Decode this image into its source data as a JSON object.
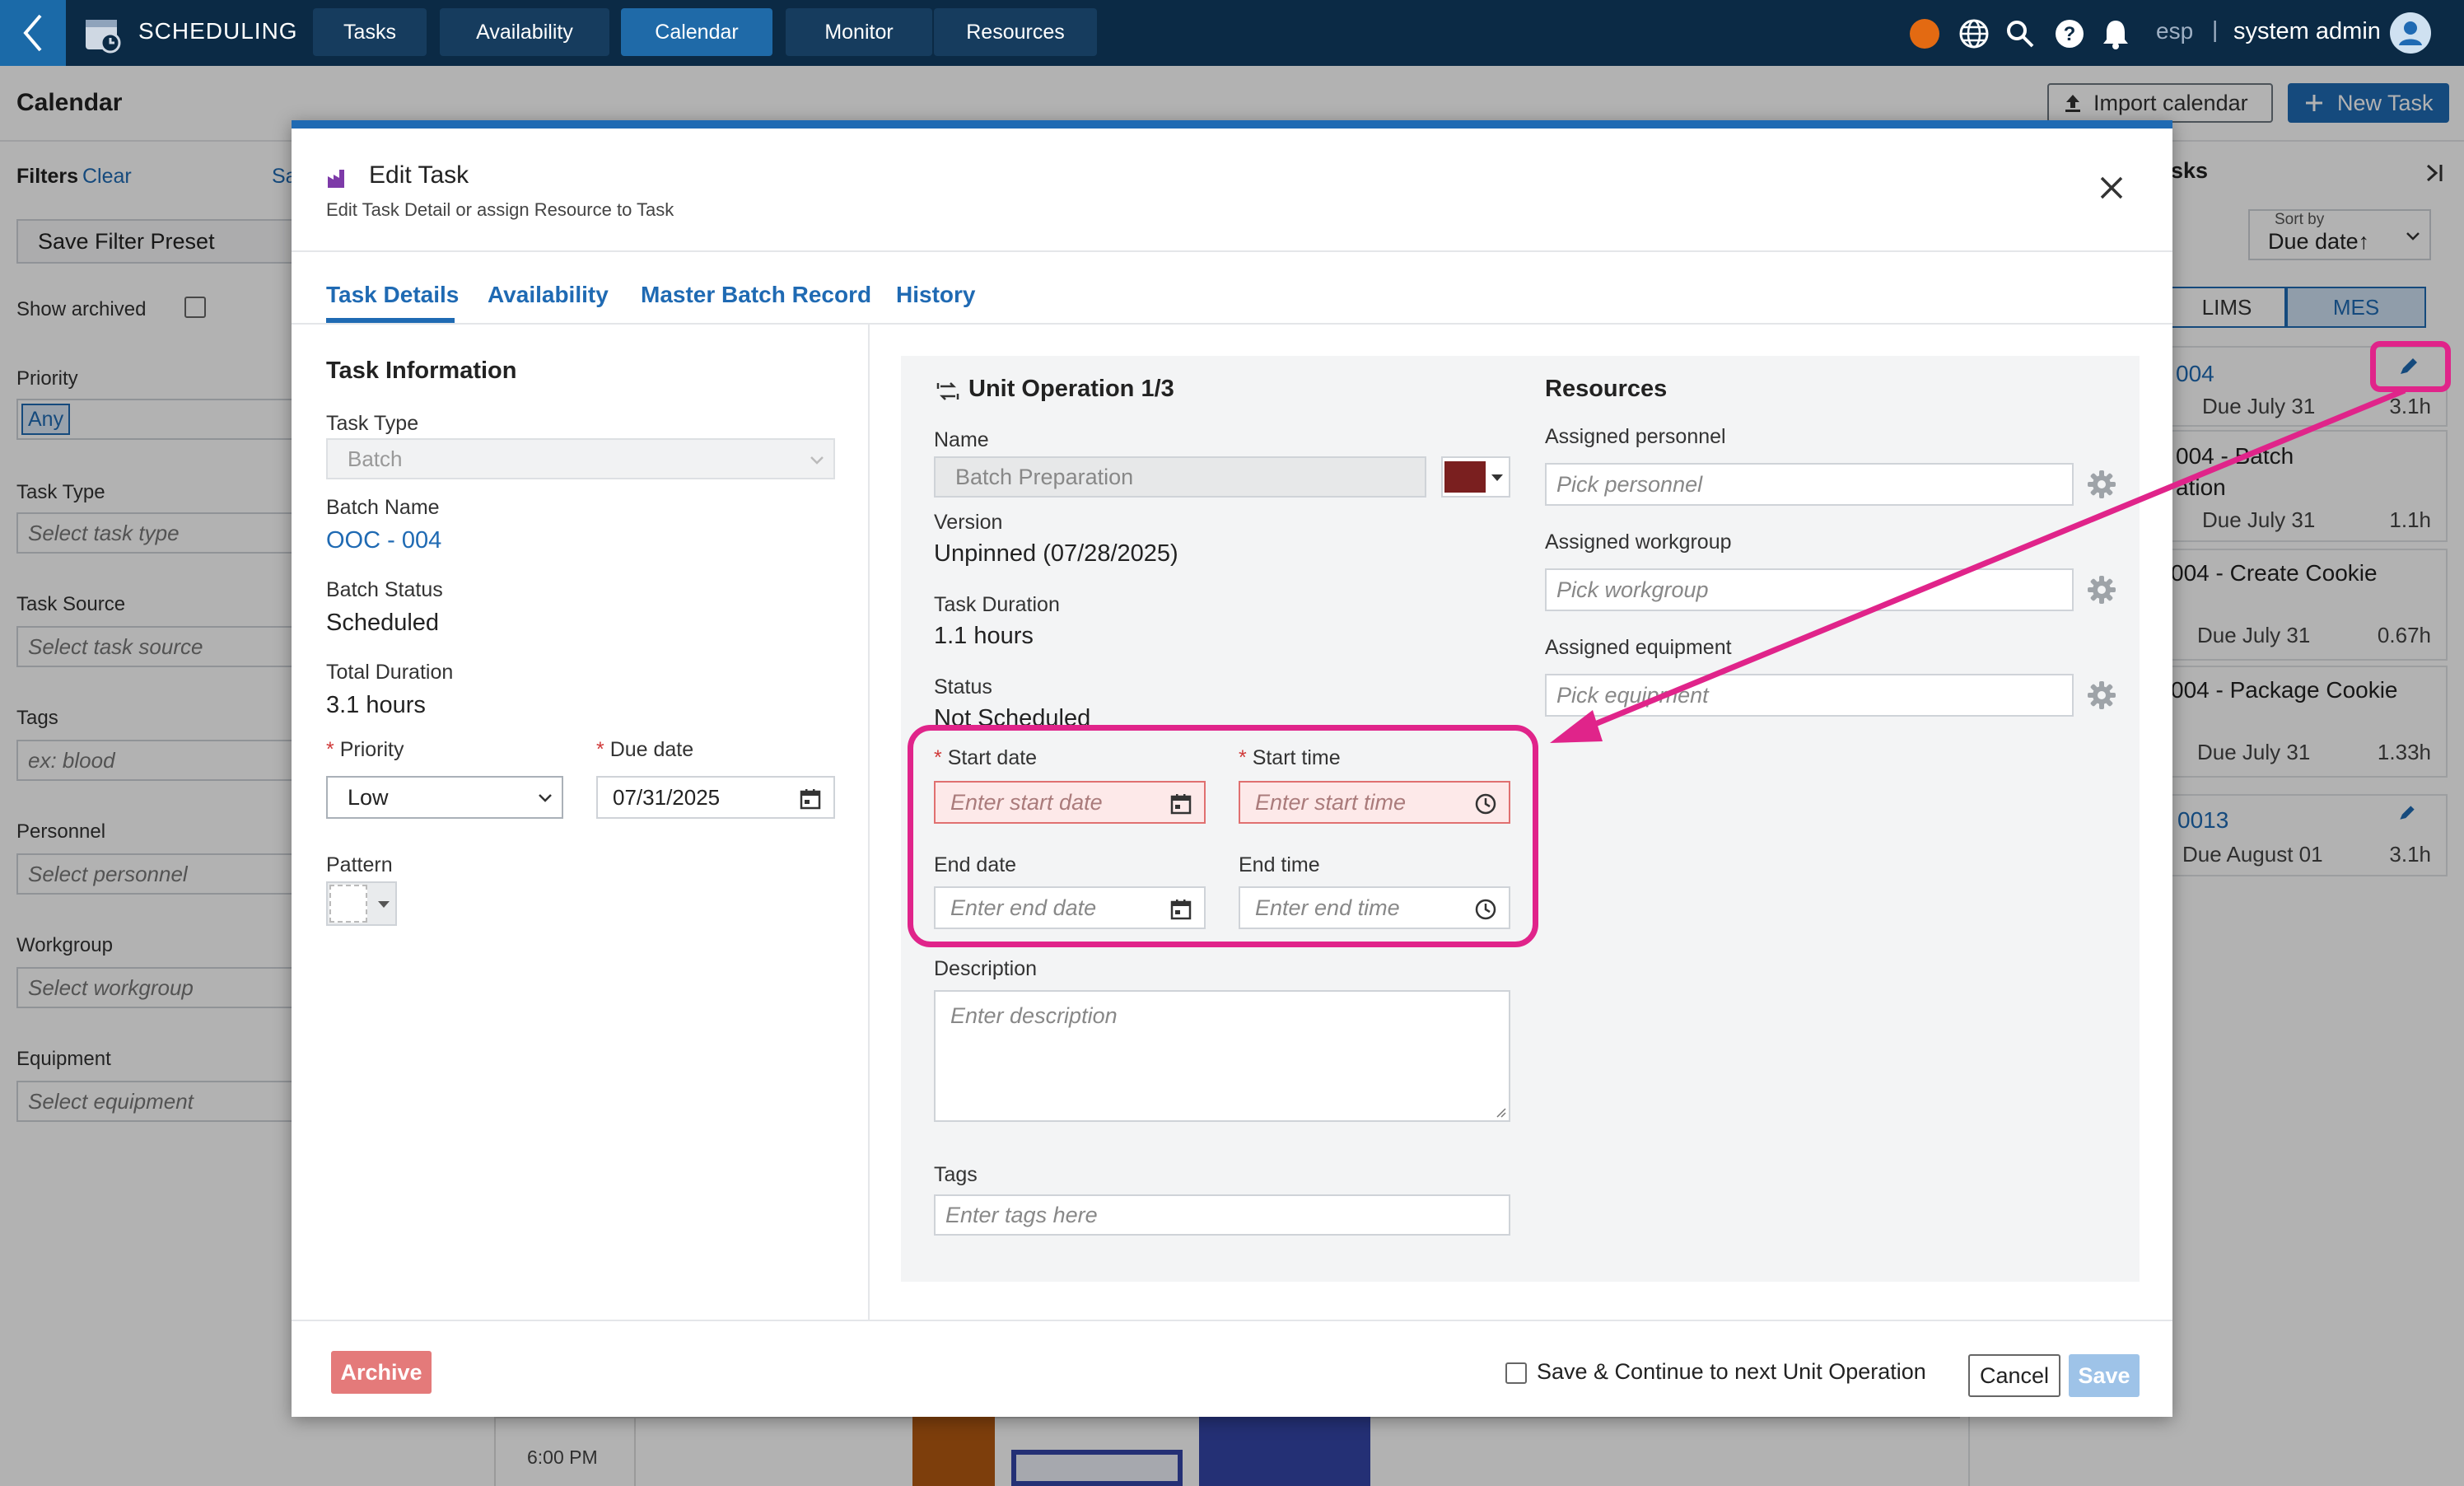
{
  "topbar": {
    "app_title": "SCHEDULING",
    "nav": [
      {
        "label": "Tasks",
        "active": false
      },
      {
        "label": "Availability",
        "active": false
      },
      {
        "label": "Calendar",
        "active": true
      },
      {
        "label": "Monitor",
        "active": false
      },
      {
        "label": "Resources",
        "active": false
      }
    ],
    "lang": "esp",
    "user": "system admin"
  },
  "page": {
    "title": "Calendar",
    "import_label": "Import calendar",
    "new_task_label": "New Task"
  },
  "filters": {
    "heading": "Filters",
    "clear": "Clear",
    "save_partial": "Sa",
    "save_preset": "Save Filter Preset",
    "show_archived": "Show archived",
    "priority_label": "Priority",
    "priority_value": "Any",
    "task_type_label": "Task Type",
    "task_type_placeholder": "Select task type",
    "task_source_label": "Task Source",
    "task_source_placeholder": "Select task source",
    "tags_label": "Tags",
    "tags_placeholder": "ex: blood",
    "personnel_label": "Personnel",
    "personnel_placeholder": "Select personnel",
    "workgroup_label": "Workgroup",
    "workgroup_placeholder": "Select workgroup",
    "equipment_label": "Equipment",
    "equipment_placeholder": "Select equipment"
  },
  "calendar": {
    "time_label": "6:00 PM"
  },
  "tasks_panel": {
    "title_partial": "sks",
    "sort_label": "Sort by",
    "sort_value": "Due date↑",
    "toggle": [
      "LIMS",
      "MES"
    ],
    "cards": [
      {
        "title": "004",
        "due": "Due July 31",
        "dur": "3.1h"
      },
      {
        "title_line1": "004 - Batch",
        "title_line2": "ation",
        "due": "Due July 31",
        "dur": "1.1h"
      },
      {
        "title": "004 - Create Cookie",
        "due": "Due July 31",
        "dur": "0.67h"
      },
      {
        "title": "004 - Package Cookie",
        "due": "Due July 31",
        "dur": "1.33h"
      },
      {
        "title": "0013",
        "due": "Due August 01",
        "dur": "3.1h"
      }
    ]
  },
  "modal": {
    "title": "Edit Task",
    "subtitle": "Edit Task Detail or assign Resource to Task",
    "tabs": [
      "Task Details",
      "Availability",
      "Master Batch Record",
      "History"
    ],
    "task_info": {
      "heading": "Task Information",
      "task_type_label": "Task Type",
      "task_type_value": "Batch",
      "batch_name_label": "Batch Name",
      "batch_name_value": "OOC - 004",
      "batch_status_label": "Batch Status",
      "batch_status_value": "Scheduled",
      "total_duration_label": "Total Duration",
      "total_duration_value": "3.1 hours",
      "priority_label": "Priority",
      "priority_value": "Low",
      "due_date_label": "Due date",
      "due_date_value": "07/31/2025",
      "pattern_label": "Pattern"
    },
    "unit_op": {
      "heading": "Unit Operation 1/3",
      "name_label": "Name",
      "name_value": "Batch Preparation",
      "name_color": "#7a1f1f",
      "version_label": "Version",
      "version_value": "Unpinned (07/28/2025)",
      "duration_label": "Task Duration",
      "duration_value": "1.1 hours",
      "status_label": "Status",
      "status_value": "Not Scheduled",
      "start_date_label": "Start date",
      "start_date_placeholder": "Enter start date",
      "start_time_label": "Start time",
      "start_time_placeholder": "Enter start time",
      "end_date_label": "End date",
      "end_date_placeholder": "Enter end date",
      "end_time_label": "End time",
      "end_time_placeholder": "Enter end time",
      "description_label": "Description",
      "description_placeholder": "Enter description",
      "tags_label": "Tags",
      "tags_placeholder": "Enter tags here"
    },
    "resources": {
      "heading": "Resources",
      "personnel_label": "Assigned personnel",
      "personnel_placeholder": "Pick personnel",
      "workgroup_label": "Assigned workgroup",
      "workgroup_placeholder": "Pick workgroup",
      "equipment_label": "Assigned equipment",
      "equipment_placeholder": "Pick equipment"
    },
    "footer": {
      "archive": "Archive",
      "save_continue": "Save & Continue to next Unit Operation",
      "cancel": "Cancel",
      "save": "Save"
    }
  },
  "colors": {
    "accent": "#1f6ab3",
    "annotation": "#e0248a",
    "topbar": "#0b2a45"
  }
}
